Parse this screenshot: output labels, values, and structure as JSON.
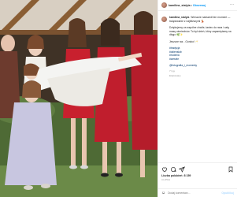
{
  "post": {
    "username": "kamilina_stalyia",
    "follow_label": "Obserwuj",
    "header_sep": "•",
    "sub_label": "Edytowany",
    "caption": {
      "line1": "Wreszcie nadszedł ten moment — świętowanie z najbliższymi 💃",
      "line2": "Dziękujemy za wspólne chwile, taniec do rana i całą masę uśmiechów. To był dzień, który zapamiętamy na długo 🌿✨",
      "line3": "Jeszcze raz - Gorzko! 🥂",
      "tags": [
        "#tradycja",
        "#dzienslub",
        "#rodzina",
        "#wesele"
      ],
      "mention": "@fotografia_i_momenty",
      "time": "7 tyg."
    },
    "likes": "Liczba polubień: 8 159",
    "date": "4 LIPCA",
    "comment_placeholder": "Dodaj komentarz...",
    "post_label": "Opublikuj",
    "icons": {
      "like": "heart-icon",
      "comment": "comment-icon",
      "share": "share-icon",
      "save": "bookmark-icon",
      "more": "more-icon",
      "emoji": "emoji-icon"
    }
  },
  "colors": {
    "accent": "#0095f6",
    "dress_red": "#c8202e",
    "dress_white": "#f4f4f2",
    "dress_lilac": "#c8c6e0",
    "grass": "#4e6a35"
  }
}
